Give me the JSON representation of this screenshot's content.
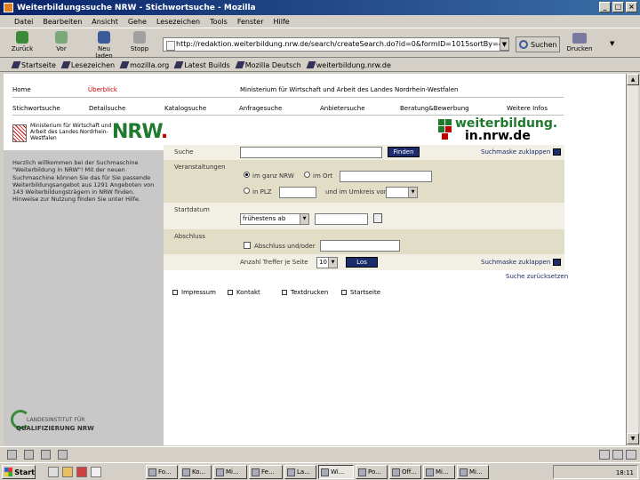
{
  "window": {
    "title": "Weiterbildungssuche NRW - Stichwortsuche - Mozilla",
    "controls": [
      "_",
      "□",
      "×"
    ]
  },
  "menu": [
    "Datei",
    "Bearbeiten",
    "Ansicht",
    "Gehe",
    "Lesezeichen",
    "Tools",
    "Fenster",
    "Hilfe"
  ],
  "toolbar": {
    "back": "Zurück",
    "forward": "Vor",
    "reload": "Neu laden",
    "stop": "Stopp",
    "url": "http://redaktion.weiterbildung.nrw.de/search/createSearch.do?id=0&formID=1015sortBy=40&order",
    "search": "Suchen",
    "print": "Drucken"
  },
  "bookmarks": [
    "Startseite",
    "Lesezeichen",
    "mozilla.org",
    "Latest Builds",
    "Mozilla Deutsch",
    "weiterbildung.nrw.de"
  ],
  "nav": {
    "home": "Home",
    "overview": "Überblick",
    "ministry_title": "Ministerium für Wirtschaft und Arbeit des Landes Nordrhein-Westfalen",
    "row2": [
      "Stichwortsuche",
      "Detailsuche",
      "Katalogsuche",
      "Anfragesuche",
      "Anbietersuche",
      "Beratung&Bewerbung",
      "Weitere Infos"
    ]
  },
  "logos": {
    "ministry": "Ministerium für Wirtschaft und Arbeit des Landes Nordrhein-Westfalen",
    "nrw": "NRW",
    "nrw_dot": ".",
    "wb_line1": "weiterbildung.",
    "wb_line2": "in.nrw.de",
    "institute_line1": "LANDESINSTITUT FÜR",
    "institute_line2": "QUALIFIZIERUNG NRW"
  },
  "welcome_text": "Herzlich willkommen bei der Suchmaschine \"Weiterbildung in NRW\"! Mit der neuen Suchmaschine können Sie das für Sie passende Weiterbildungsangebot aus 1291 Angeboten von 143 Weiterbildungsträgern in NRW finden. Hinweise zur Nutzung finden Sie unter Hilfe.",
  "form": {
    "search_label": "Suche",
    "find_btn": "Finden",
    "reset_mask": "Suchmaske zuklappen",
    "location_label": "Veranstaltungen",
    "radio_all_nrw": "im ganz NRW",
    "radio_in_city": "im Ort",
    "radio_plz": "in PLZ",
    "radius_label": "und im Umkreis von",
    "start_label": "Startdatum",
    "start_select": "frühestens ab",
    "degree_label": "Abschluss",
    "degree_checkbox": "Abschluss und/oder",
    "hits_label": "Anzahl Treffer je Seite",
    "hits_value": "10",
    "go_btn": "Los",
    "reset_mask2": "Suchmaske zuklappen",
    "back_link": "Suche zurücksetzen"
  },
  "footer": [
    "Impressum",
    "Kontakt",
    "Textdrucken",
    "Startseite"
  ],
  "taskbar": {
    "start": "Start",
    "tasks": [
      "Fo...",
      "Ko...",
      "Mi...",
      "Fe...",
      "La...",
      "Wi...",
      "Po...",
      "Off...",
      "Mi...",
      "Mi..."
    ],
    "clock": "18:11"
  },
  "colors": {
    "nrw_green": "#1f7a2e",
    "nrw_red": "#c00000",
    "button_navy": "#1b2b6b"
  }
}
